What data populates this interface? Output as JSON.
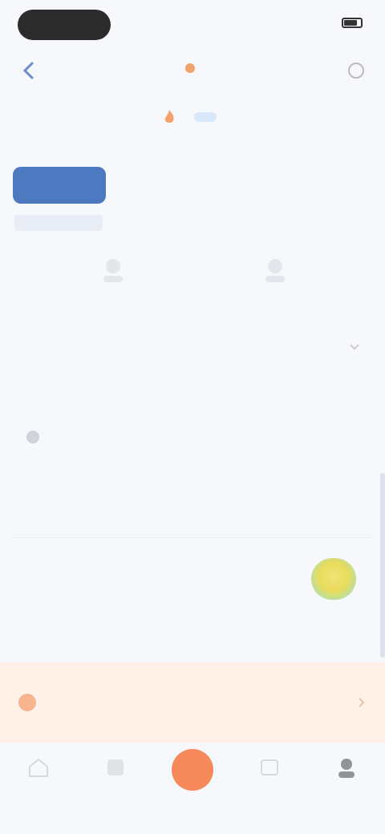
{
  "status": {
    "time": "",
    "right": ""
  },
  "header": {
    "title": ""
  },
  "promo": {
    "text": "",
    "link": "",
    "more": ""
  },
  "plans": {
    "section_title": "",
    "tabs": [
      {
        "label": "",
        "tag": ""
      },
      {
        "label": "",
        "tag": ""
      },
      {
        "label": "",
        "tag": ""
      },
      {
        "label": "",
        "tag": ""
      }
    ],
    "note": ""
  },
  "choices": [
    {
      "label": ""
    },
    {
      "label": ""
    }
  ],
  "details": {
    "section_title": "",
    "title": "",
    "price": "",
    "columns": [
      {
        "value": "",
        "key": ""
      },
      {
        "value": "",
        "key": ""
      },
      {
        "value": "",
        "key": ""
      }
    ]
  },
  "payment": {
    "label": ""
  },
  "notice": {
    "line1": "",
    "line2": ""
  },
  "tabbar": {
    "items": [
      {
        "label": "",
        "icon": "home-icon"
      },
      {
        "label": "",
        "icon": "list-icon"
      },
      {
        "label": "",
        "icon": "center-action-icon"
      },
      {
        "label": "",
        "icon": "message-icon"
      },
      {
        "label": "",
        "icon": "profile-icon"
      }
    ]
  },
  "colors": {
    "accent": "#4d79c1",
    "orange": "#f5895a",
    "notice_bg": "#fdf1e8"
  }
}
